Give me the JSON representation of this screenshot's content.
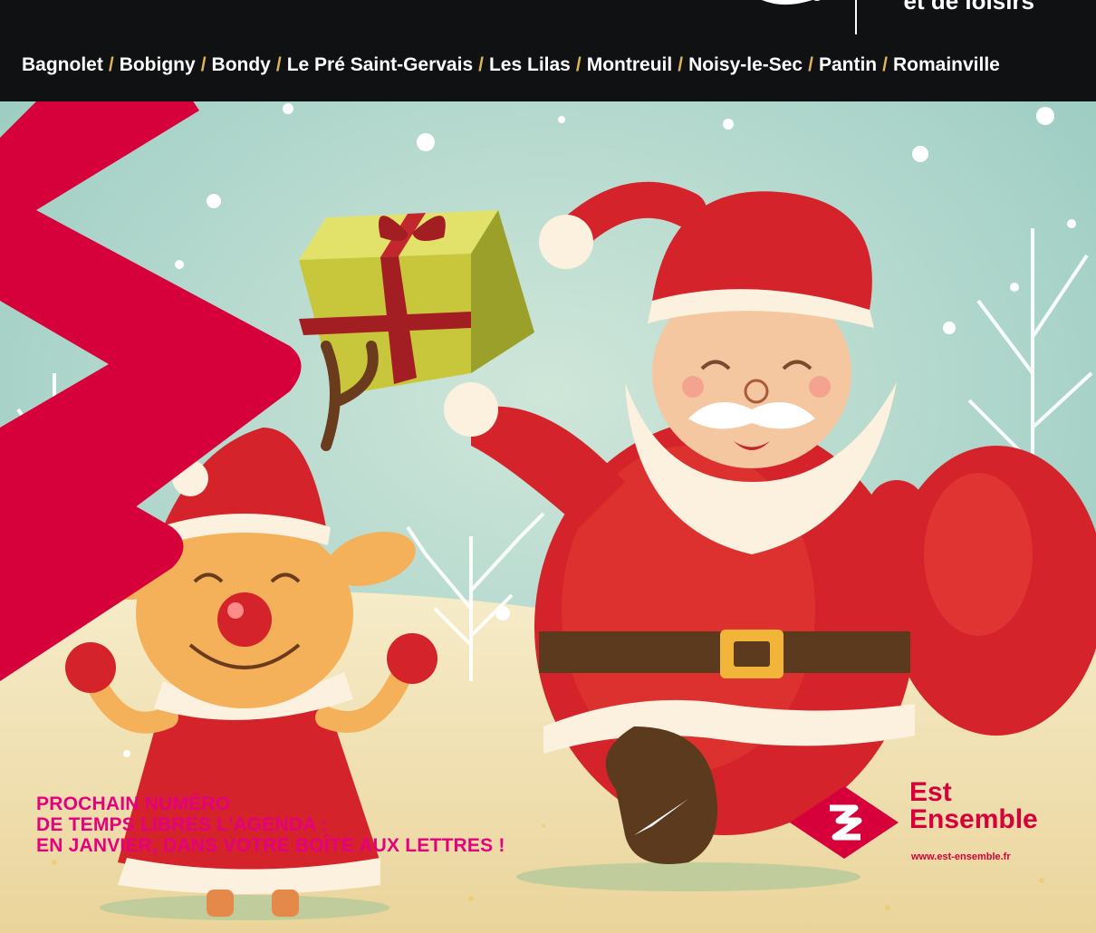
{
  "header": {
    "tagline": "et de loisirs",
    "cities": [
      "Bagnolet",
      "Bobigny",
      "Bondy",
      "Le Pré Saint-Gervais",
      "Les Lilas",
      "Montreuil",
      "Noisy-le-Sec",
      "Pantin",
      "Romainville"
    ],
    "separator": "/"
  },
  "notice": {
    "line1": "PROCHAIN NUMÉRO",
    "line2": "DE TEMPS LIBRES L'AGENDA :",
    "line3": "EN JANVIER, DANS VOTRE BOÎTE AUX LETTRES !"
  },
  "brand": {
    "name_line1": "Est",
    "name_line2": "Ensemble",
    "url": "www.est-ensemble.fr",
    "color": "#d6003a"
  },
  "illustration": {
    "icons": [
      "brand-bolt-icon",
      "santa-illustration",
      "reindeer-illustration",
      "gift-box-icon",
      "snow-trees"
    ]
  },
  "colors": {
    "topbar": "#0f1112",
    "accent": "#d6003a",
    "notice_text": "#e5007e",
    "sky": "#a9d3c9"
  }
}
